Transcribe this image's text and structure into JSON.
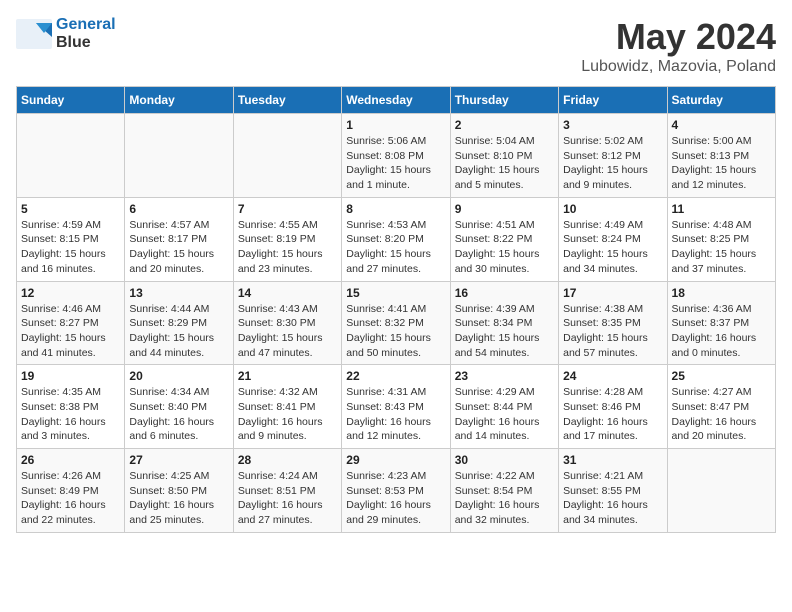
{
  "header": {
    "logo_line1": "General",
    "logo_line2": "Blue",
    "title": "May 2024",
    "subtitle": "Lubowidz, Mazovia, Poland"
  },
  "weekdays": [
    "Sunday",
    "Monday",
    "Tuesday",
    "Wednesday",
    "Thursday",
    "Friday",
    "Saturday"
  ],
  "weeks": [
    [
      {
        "day": "",
        "info": ""
      },
      {
        "day": "",
        "info": ""
      },
      {
        "day": "",
        "info": ""
      },
      {
        "day": "1",
        "info": "Sunrise: 5:06 AM\nSunset: 8:08 PM\nDaylight: 15 hours\nand 1 minute."
      },
      {
        "day": "2",
        "info": "Sunrise: 5:04 AM\nSunset: 8:10 PM\nDaylight: 15 hours\nand 5 minutes."
      },
      {
        "day": "3",
        "info": "Sunrise: 5:02 AM\nSunset: 8:12 PM\nDaylight: 15 hours\nand 9 minutes."
      },
      {
        "day": "4",
        "info": "Sunrise: 5:00 AM\nSunset: 8:13 PM\nDaylight: 15 hours\nand 12 minutes."
      }
    ],
    [
      {
        "day": "5",
        "info": "Sunrise: 4:59 AM\nSunset: 8:15 PM\nDaylight: 15 hours\nand 16 minutes."
      },
      {
        "day": "6",
        "info": "Sunrise: 4:57 AM\nSunset: 8:17 PM\nDaylight: 15 hours\nand 20 minutes."
      },
      {
        "day": "7",
        "info": "Sunrise: 4:55 AM\nSunset: 8:19 PM\nDaylight: 15 hours\nand 23 minutes."
      },
      {
        "day": "8",
        "info": "Sunrise: 4:53 AM\nSunset: 8:20 PM\nDaylight: 15 hours\nand 27 minutes."
      },
      {
        "day": "9",
        "info": "Sunrise: 4:51 AM\nSunset: 8:22 PM\nDaylight: 15 hours\nand 30 minutes."
      },
      {
        "day": "10",
        "info": "Sunrise: 4:49 AM\nSunset: 8:24 PM\nDaylight: 15 hours\nand 34 minutes."
      },
      {
        "day": "11",
        "info": "Sunrise: 4:48 AM\nSunset: 8:25 PM\nDaylight: 15 hours\nand 37 minutes."
      }
    ],
    [
      {
        "day": "12",
        "info": "Sunrise: 4:46 AM\nSunset: 8:27 PM\nDaylight: 15 hours\nand 41 minutes."
      },
      {
        "day": "13",
        "info": "Sunrise: 4:44 AM\nSunset: 8:29 PM\nDaylight: 15 hours\nand 44 minutes."
      },
      {
        "day": "14",
        "info": "Sunrise: 4:43 AM\nSunset: 8:30 PM\nDaylight: 15 hours\nand 47 minutes."
      },
      {
        "day": "15",
        "info": "Sunrise: 4:41 AM\nSunset: 8:32 PM\nDaylight: 15 hours\nand 50 minutes."
      },
      {
        "day": "16",
        "info": "Sunrise: 4:39 AM\nSunset: 8:34 PM\nDaylight: 15 hours\nand 54 minutes."
      },
      {
        "day": "17",
        "info": "Sunrise: 4:38 AM\nSunset: 8:35 PM\nDaylight: 15 hours\nand 57 minutes."
      },
      {
        "day": "18",
        "info": "Sunrise: 4:36 AM\nSunset: 8:37 PM\nDaylight: 16 hours\nand 0 minutes."
      }
    ],
    [
      {
        "day": "19",
        "info": "Sunrise: 4:35 AM\nSunset: 8:38 PM\nDaylight: 16 hours\nand 3 minutes."
      },
      {
        "day": "20",
        "info": "Sunrise: 4:34 AM\nSunset: 8:40 PM\nDaylight: 16 hours\nand 6 minutes."
      },
      {
        "day": "21",
        "info": "Sunrise: 4:32 AM\nSunset: 8:41 PM\nDaylight: 16 hours\nand 9 minutes."
      },
      {
        "day": "22",
        "info": "Sunrise: 4:31 AM\nSunset: 8:43 PM\nDaylight: 16 hours\nand 12 minutes."
      },
      {
        "day": "23",
        "info": "Sunrise: 4:29 AM\nSunset: 8:44 PM\nDaylight: 16 hours\nand 14 minutes."
      },
      {
        "day": "24",
        "info": "Sunrise: 4:28 AM\nSunset: 8:46 PM\nDaylight: 16 hours\nand 17 minutes."
      },
      {
        "day": "25",
        "info": "Sunrise: 4:27 AM\nSunset: 8:47 PM\nDaylight: 16 hours\nand 20 minutes."
      }
    ],
    [
      {
        "day": "26",
        "info": "Sunrise: 4:26 AM\nSunset: 8:49 PM\nDaylight: 16 hours\nand 22 minutes."
      },
      {
        "day": "27",
        "info": "Sunrise: 4:25 AM\nSunset: 8:50 PM\nDaylight: 16 hours\nand 25 minutes."
      },
      {
        "day": "28",
        "info": "Sunrise: 4:24 AM\nSunset: 8:51 PM\nDaylight: 16 hours\nand 27 minutes."
      },
      {
        "day": "29",
        "info": "Sunrise: 4:23 AM\nSunset: 8:53 PM\nDaylight: 16 hours\nand 29 minutes."
      },
      {
        "day": "30",
        "info": "Sunrise: 4:22 AM\nSunset: 8:54 PM\nDaylight: 16 hours\nand 32 minutes."
      },
      {
        "day": "31",
        "info": "Sunrise: 4:21 AM\nSunset: 8:55 PM\nDaylight: 16 hours\nand 34 minutes."
      },
      {
        "day": "",
        "info": ""
      }
    ]
  ]
}
